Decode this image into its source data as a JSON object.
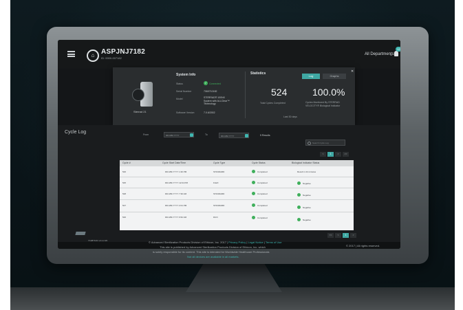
{
  "header": {
    "device_title": "ASPJNJ7182",
    "device_subtitle": "ID: 0000-007182",
    "department": "All Departments",
    "notification_count": "12"
  },
  "system_info": {
    "title": "System Info",
    "device_label": "Sterrad 21",
    "rows": [
      {
        "label": "Status",
        "value": "Connected"
      },
      {
        "label": "Serial Number",
        "value": "7060710182"
      },
      {
        "label": "Model",
        "value": "STERRAD® 100NX System with ALLClear™ Technology"
      },
      {
        "label": "Software Version",
        "value": "7.0.6/2002"
      }
    ]
  },
  "statistics": {
    "title": "Statistics",
    "tabs": [
      "Log",
      "Graphs"
    ],
    "total_cycles": "524",
    "total_cycles_label": "Total Cycles Completed",
    "percent": "100.0%",
    "percent_label": "Cycles Monitored By STERRAD VELOCITY® Biological Indicator",
    "period": "Last 30 days"
  },
  "cycle_log": {
    "title": "Cycle Log",
    "from_label": "From",
    "from_value": "DD-MM-YYYY",
    "to_label": "To",
    "to_value": "DD-MM-YYYY",
    "results": "5 Results",
    "search_placeholder": "Search Cycle Log",
    "pages": [
      "<",
      "1",
      ">",
      ">>"
    ],
    "columns": [
      "Cycle #",
      "Cycle Start Date/Time",
      "Cycle Type",
      "Cycle Status",
      "Biological Indicator Status"
    ],
    "rows": [
      {
        "num": "526",
        "date": "DD-MM-YYYY 1:30 PM",
        "type": "STANDARD",
        "status": "Completed",
        "bi": "Result in 24 minutes"
      },
      {
        "num": "525",
        "date": "DD-MM-YYYY 12:04 PM",
        "type": "FLEX",
        "status": "Completed",
        "bi": "Negative"
      },
      {
        "num": "528",
        "date": "DD-MM-YYYY 7:30 AM",
        "type": "STANDARD",
        "status": "Completed",
        "bi": "Negative"
      },
      {
        "num": "527",
        "date": "DD-MM-YYYY 2:01 PM",
        "type": "STANDARD",
        "status": "Completed",
        "bi": "Negative"
      },
      {
        "num": "526",
        "date": "DD-MM-YYYY 9:52 AM",
        "type": "DUO",
        "status": "Completed",
        "bi": "Negative"
      }
    ],
    "bottom_pages": [
      "<<",
      "<",
      "1",
      ">"
    ]
  },
  "footer": {
    "version": "7C2870-01 v4.1.2.26",
    "line1": "© Advanced Sterilization Products Division of Ethicon, Inc. 2017 |",
    "privacy": "Privacy Policy",
    "legal": "Legal Notice",
    "terms": "Terms of Use",
    "line2": "This site is published by Advanced Sterilization Products Division of Ethicon, Inc. which",
    "line3": "is solely responsible for its content. This site is intended for Worldwide Healthcare Professionals",
    "line4": "Not all devices are available in all markets.",
    "copyright": "© 2017 | All rights reserved."
  }
}
